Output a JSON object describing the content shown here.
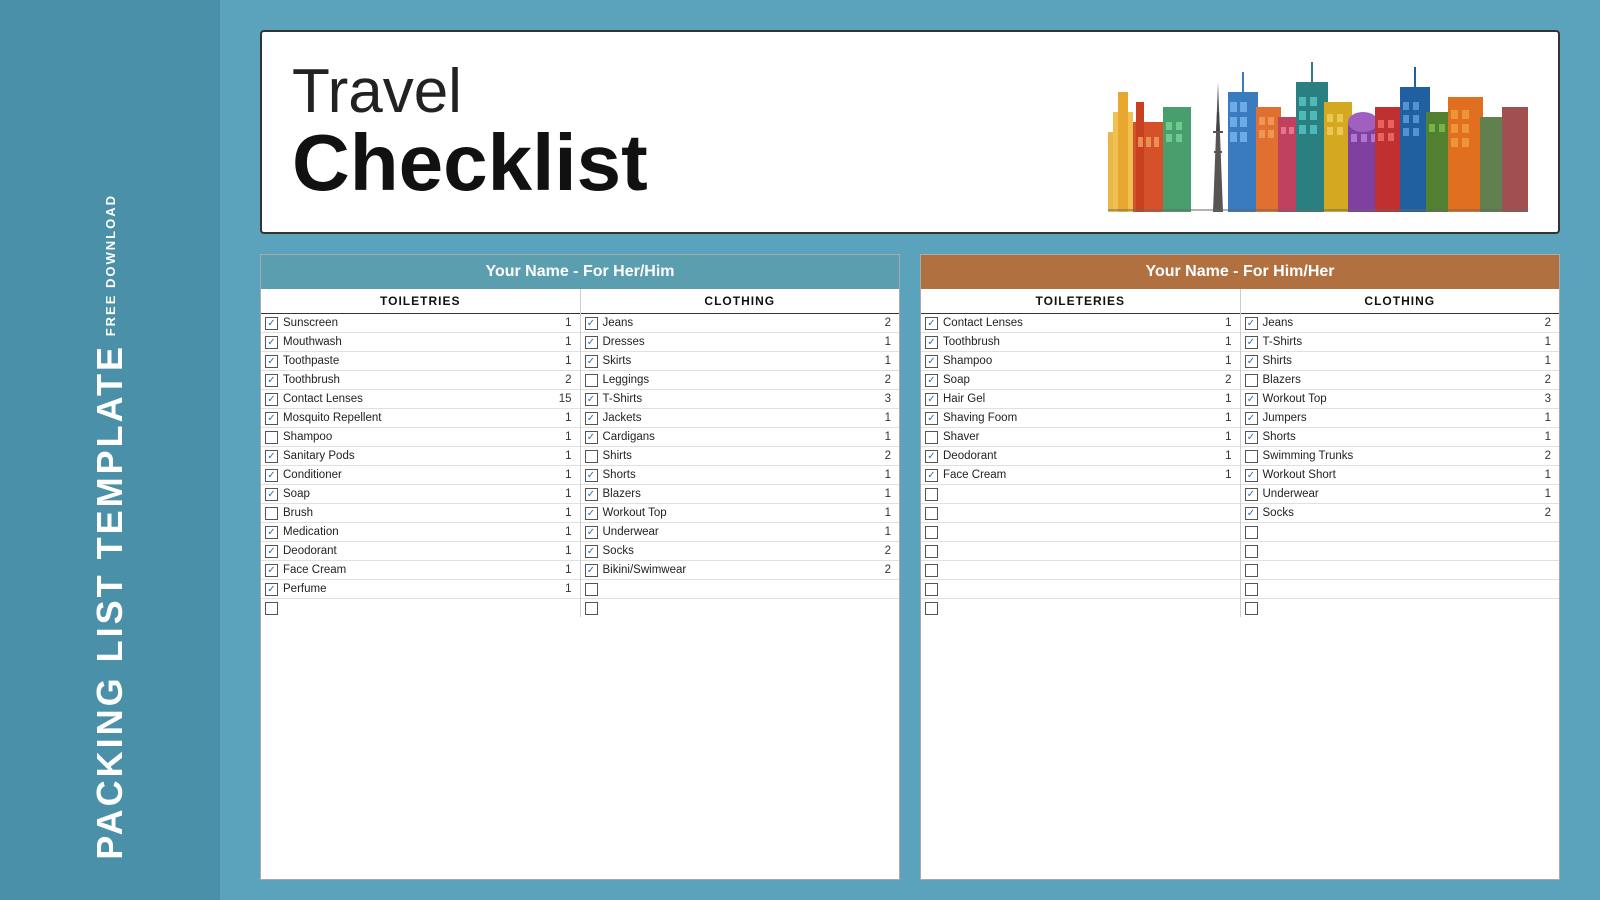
{
  "sidebar": {
    "free_label": "FREE DOWNLOAD",
    "title": "PACKING LIST TEMPLATE"
  },
  "header": {
    "title_light": "Travel",
    "title_bold": "Checklist"
  },
  "her_card": {
    "header": "Your Name - For Her/Him",
    "toiletries_col": "TOILETRIES",
    "clothing_col": "CLOTHING",
    "toiletries": [
      {
        "checked": true,
        "name": "Sunscreen",
        "qty": "1"
      },
      {
        "checked": true,
        "name": "Mouthwash",
        "qty": "1"
      },
      {
        "checked": true,
        "name": "Toothpaste",
        "qty": "1"
      },
      {
        "checked": true,
        "name": "Toothbrush",
        "qty": "2"
      },
      {
        "checked": true,
        "name": "Contact Lenses",
        "qty": "15"
      },
      {
        "checked": true,
        "name": "Mosquito Repellent",
        "qty": "1"
      },
      {
        "checked": false,
        "name": "Shampoo",
        "qty": "1"
      },
      {
        "checked": true,
        "name": "Sanitary Pods",
        "qty": "1"
      },
      {
        "checked": true,
        "name": "Conditioner",
        "qty": "1"
      },
      {
        "checked": true,
        "name": "Soap",
        "qty": "1"
      },
      {
        "checked": false,
        "name": "Brush",
        "qty": "1"
      },
      {
        "checked": true,
        "name": "Medication",
        "qty": "1"
      },
      {
        "checked": true,
        "name": "Deodorant",
        "qty": "1"
      },
      {
        "checked": true,
        "name": "Face Cream",
        "qty": "1"
      },
      {
        "checked": true,
        "name": "Perfume",
        "qty": "1"
      },
      {
        "checked": false,
        "name": "",
        "qty": ""
      }
    ],
    "clothing": [
      {
        "checked": true,
        "name": "Jeans",
        "qty": "2"
      },
      {
        "checked": true,
        "name": "Dresses",
        "qty": "1"
      },
      {
        "checked": true,
        "name": "Skirts",
        "qty": "1"
      },
      {
        "checked": false,
        "name": "Leggings",
        "qty": "2"
      },
      {
        "checked": true,
        "name": "T-Shirts",
        "qty": "3"
      },
      {
        "checked": true,
        "name": "Jackets",
        "qty": "1"
      },
      {
        "checked": true,
        "name": "Cardigans",
        "qty": "1"
      },
      {
        "checked": false,
        "name": "Shirts",
        "qty": "2"
      },
      {
        "checked": true,
        "name": "Shorts",
        "qty": "1"
      },
      {
        "checked": true,
        "name": "Blazers",
        "qty": "1"
      },
      {
        "checked": true,
        "name": "Workout Top",
        "qty": "1"
      },
      {
        "checked": true,
        "name": "Underwear",
        "qty": "1"
      },
      {
        "checked": true,
        "name": "Socks",
        "qty": "2"
      },
      {
        "checked": true,
        "name": "Bikini/Swimwear",
        "qty": "2"
      },
      {
        "checked": false,
        "name": "",
        "qty": ""
      },
      {
        "checked": false,
        "name": "",
        "qty": ""
      }
    ]
  },
  "him_card": {
    "header": "Your Name - For Him/Her",
    "toiletries_col": "TOILETERIES",
    "clothing_col": "CLOTHING",
    "toiletries": [
      {
        "checked": true,
        "name": "Contact Lenses",
        "qty": "1"
      },
      {
        "checked": true,
        "name": "Toothbrush",
        "qty": "1"
      },
      {
        "checked": true,
        "name": "Shampoo",
        "qty": "1"
      },
      {
        "checked": true,
        "name": "Soap",
        "qty": "2"
      },
      {
        "checked": true,
        "name": "Hair Gel",
        "qty": "1"
      },
      {
        "checked": true,
        "name": "Shaving Foom",
        "qty": "1"
      },
      {
        "checked": false,
        "name": "Shaver",
        "qty": "1"
      },
      {
        "checked": true,
        "name": "Deodorant",
        "qty": "1"
      },
      {
        "checked": true,
        "name": "Face Cream",
        "qty": "1"
      },
      {
        "checked": false,
        "name": "",
        "qty": ""
      },
      {
        "checked": false,
        "name": "",
        "qty": ""
      },
      {
        "checked": false,
        "name": "",
        "qty": ""
      },
      {
        "checked": false,
        "name": "",
        "qty": ""
      },
      {
        "checked": false,
        "name": "",
        "qty": ""
      },
      {
        "checked": false,
        "name": "",
        "qty": ""
      },
      {
        "checked": false,
        "name": "",
        "qty": ""
      }
    ],
    "clothing": [
      {
        "checked": true,
        "name": "Jeans",
        "qty": "2"
      },
      {
        "checked": true,
        "name": "T-Shirts",
        "qty": "1"
      },
      {
        "checked": true,
        "name": "Shirts",
        "qty": "1"
      },
      {
        "checked": false,
        "name": "Blazers",
        "qty": "2"
      },
      {
        "checked": true,
        "name": "Workout Top",
        "qty": "3"
      },
      {
        "checked": true,
        "name": "Jumpers",
        "qty": "1"
      },
      {
        "checked": true,
        "name": "Shorts",
        "qty": "1"
      },
      {
        "checked": false,
        "name": "Swimming Trunks",
        "qty": "2"
      },
      {
        "checked": true,
        "name": "Workout Short",
        "qty": "1"
      },
      {
        "checked": true,
        "name": "Underwear",
        "qty": "1"
      },
      {
        "checked": true,
        "name": "Socks",
        "qty": "2"
      },
      {
        "checked": false,
        "name": "",
        "qty": ""
      },
      {
        "checked": false,
        "name": "",
        "qty": ""
      },
      {
        "checked": false,
        "name": "",
        "qty": ""
      },
      {
        "checked": false,
        "name": "",
        "qty": ""
      },
      {
        "checked": false,
        "name": "",
        "qty": ""
      }
    ]
  }
}
